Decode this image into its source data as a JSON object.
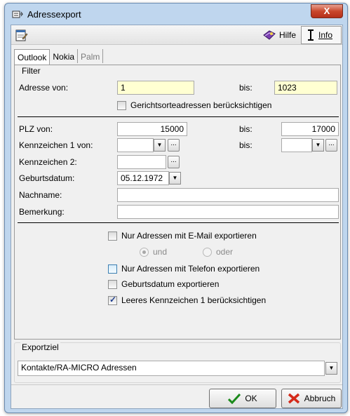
{
  "window": {
    "title": "Adressexport",
    "close_glyph": "X"
  },
  "toolbar": {
    "hilfe_label": "Hilfe",
    "info_label": "Info"
  },
  "tabs": [
    {
      "label": "Outlook",
      "active": true
    },
    {
      "label": "Nokia",
      "active": false
    },
    {
      "label": "Palm",
      "active": false
    }
  ],
  "filter": {
    "group_label": "Filter",
    "adresse_von_label": "Adresse von:",
    "adresse_von_value": "1",
    "bis_label": "bis:",
    "adresse_bis_value": "1023",
    "gericht_label": "Gerichtsorteadressen berücksichtigen",
    "plz_von_label": "PLZ von:",
    "plz_von_value": "15000",
    "plz_bis_value": "17000",
    "kz1_label": "Kennzeichen 1 von:",
    "kz2_label": "Kennzeichen 2:",
    "geburtsdatum_label": "Geburtsdatum:",
    "geburtsdatum_value": "05.12.1972",
    "nachname_label": "Nachname:",
    "bemerkung_label": "Bemerkung:"
  },
  "options": {
    "email_label": "Nur Adressen mit E-Mail exportieren",
    "und_label": "und",
    "oder_label": "oder",
    "telefon_label": "Nur Adressen mit Telefon exportieren",
    "geburtsdatum_export_label": "Geburtsdatum exportieren",
    "leeres_kz_label": "Leeres Kennzeichen 1 berücksichtigen"
  },
  "exportziel": {
    "group_label": "Exportziel",
    "selected": "Kontakte/RA-MICRO Adressen"
  },
  "buttons": {
    "ok": "OK",
    "abbruch": "Abbruch"
  },
  "icons": {
    "window": "address-export-icon",
    "toolbar_left": "notepad-icon",
    "hilfe": "help-book-icon",
    "info": "info-icon",
    "ok": "checkmark-icon",
    "abbruch": "cross-icon"
  }
}
